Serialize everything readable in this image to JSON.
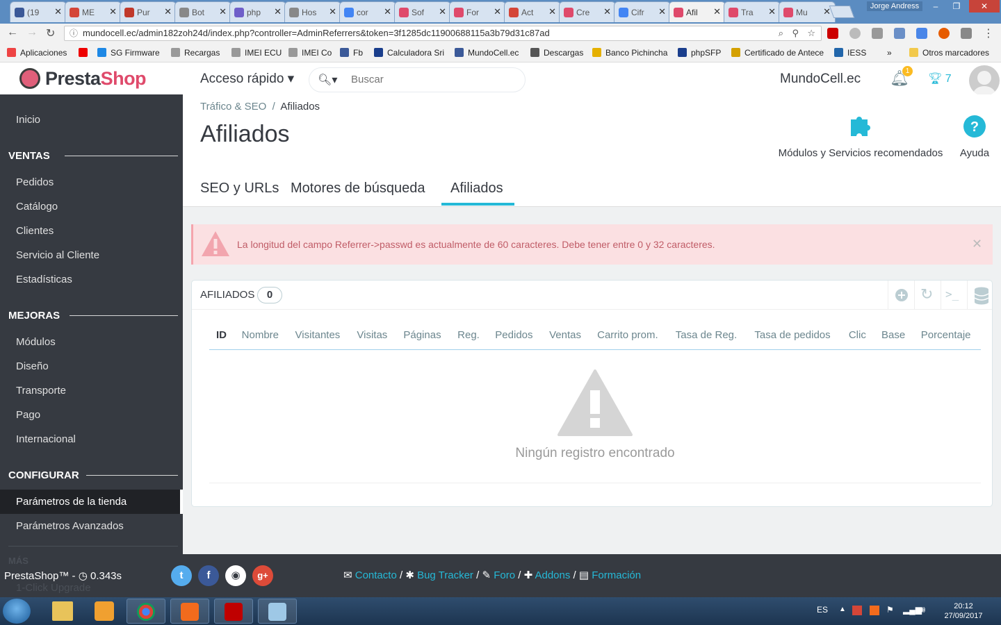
{
  "browser": {
    "tabs": [
      {
        "label": "(19",
        "color": "#3b5998"
      },
      {
        "label": "ME",
        "color": "#d44638"
      },
      {
        "label": "Pur",
        "color": "#c0392b"
      },
      {
        "label": "Bot",
        "color": "#888888"
      },
      {
        "label": "php",
        "color": "#6f5fc9"
      },
      {
        "label": "Hos",
        "color": "#888888"
      },
      {
        "label": "cor",
        "color": "#4285f4"
      },
      {
        "label": "Sof",
        "color": "#df4a6b"
      },
      {
        "label": "For",
        "color": "#df4a6b"
      },
      {
        "label": "Act",
        "color": "#d44638"
      },
      {
        "label": "Cre",
        "color": "#df4a6b"
      },
      {
        "label": "Cifr",
        "color": "#4285f4"
      },
      {
        "label": "Afil",
        "color": "#df4a6b",
        "active": true
      },
      {
        "label": "Tra",
        "color": "#df4a6b"
      },
      {
        "label": "Mu",
        "color": "#df4a6b"
      }
    ],
    "user_chip": "Jorge Andress",
    "url": "mundocell.ec/admin182zoh24d/index.php?controller=AdminReferrers&token=3f1285dc11900688115a3b79d31c87ad",
    "bookmarks": [
      {
        "label": "Aplicaciones",
        "color": "#e44"
      },
      {
        "label": "",
        "color": "#e00"
      },
      {
        "label": "SG Firmware",
        "color": "#1e88e5"
      },
      {
        "label": "Recargas",
        "color": "#999"
      },
      {
        "label": "IMEI ECU",
        "color": "#999"
      },
      {
        "label": "IMEI Co",
        "color": "#999"
      },
      {
        "label": "Fb",
        "color": "#3b5998"
      },
      {
        "label": "Calculadora Sri",
        "color": "#1a3e8c"
      },
      {
        "label": "MundoCell.ec",
        "color": "#3b5998"
      },
      {
        "label": "Descargas",
        "color": "#555"
      },
      {
        "label": "Banco Pichincha",
        "color": "#e5b000"
      },
      {
        "label": "phpSFP",
        "color": "#1a3e8c"
      },
      {
        "label": "Certificado de Antece",
        "color": "#d4a000"
      },
      {
        "label": "IESS",
        "color": "#2266aa"
      },
      {
        "label": "»",
        "color": ""
      },
      {
        "label": "Otros marcadores",
        "color": "#f2c94c"
      }
    ]
  },
  "header": {
    "logo_presta": "Presta",
    "logo_shop": "Shop",
    "quick_access": "Acceso rápido ▾",
    "search_placeholder": "Buscar",
    "shop_name": "MundoCell.ec",
    "notifications_count": "1",
    "trophy_count": "7"
  },
  "sidebar": {
    "home": "Inicio",
    "sections": [
      {
        "title": "VENTAS",
        "items": [
          "Pedidos",
          "Catálogo",
          "Clientes",
          "Servicio al Cliente",
          "Estadísticas"
        ]
      },
      {
        "title": "MEJORAS",
        "items": [
          "Módulos",
          "Diseño",
          "Transporte",
          "Pago",
          "Internacional"
        ]
      },
      {
        "title": "CONFIGURAR",
        "items": [
          "Parámetros de la tienda",
          "Parámetros Avanzados"
        ]
      }
    ],
    "more": "MÁS",
    "upgrade": "1-Click Upgrade"
  },
  "content": {
    "breadcrumb_parent": "Tráfico & SEO",
    "breadcrumb_sep": "/",
    "breadcrumb_current": "Afiliados",
    "title": "Afiliados",
    "modules_reco": "Módulos y Servicios recomendados",
    "help": "Ayuda",
    "tabs": [
      "SEO y URLs",
      "Motores de búsqueda",
      "Afiliados"
    ],
    "alert": "La longitud del campo Referrer->passwd es actualmente de 60 caracteres. Debe tener entre 0 y 32 caracteres.",
    "panel_title": "AFILIADOS",
    "panel_count": "0",
    "columns": [
      "ID",
      "Nombre",
      "Visitantes",
      "Visitas",
      "Páginas",
      "Reg.",
      "Pedidos",
      "Ventas",
      "Carrito prom.",
      "Tasa de Reg.",
      "Tasa de pedidos",
      "Clic",
      "Base",
      "Porcentaje"
    ],
    "empty": "Ningún registro encontrado"
  },
  "footer": {
    "version": "PrestaShop™ - ",
    "load_time": "0.343s",
    "links": [
      "Contacto",
      "Bug Tracker",
      "Foro",
      "Addons",
      "Formación"
    ]
  },
  "taskbar": {
    "lang": "ES",
    "time": "20:12",
    "date": "27/09/2017"
  },
  "colors": {
    "accent": "#25b9d7",
    "brand": "#df4a6b",
    "sidebar": "#363a41",
    "alert_bg": "#fbe0e2"
  }
}
